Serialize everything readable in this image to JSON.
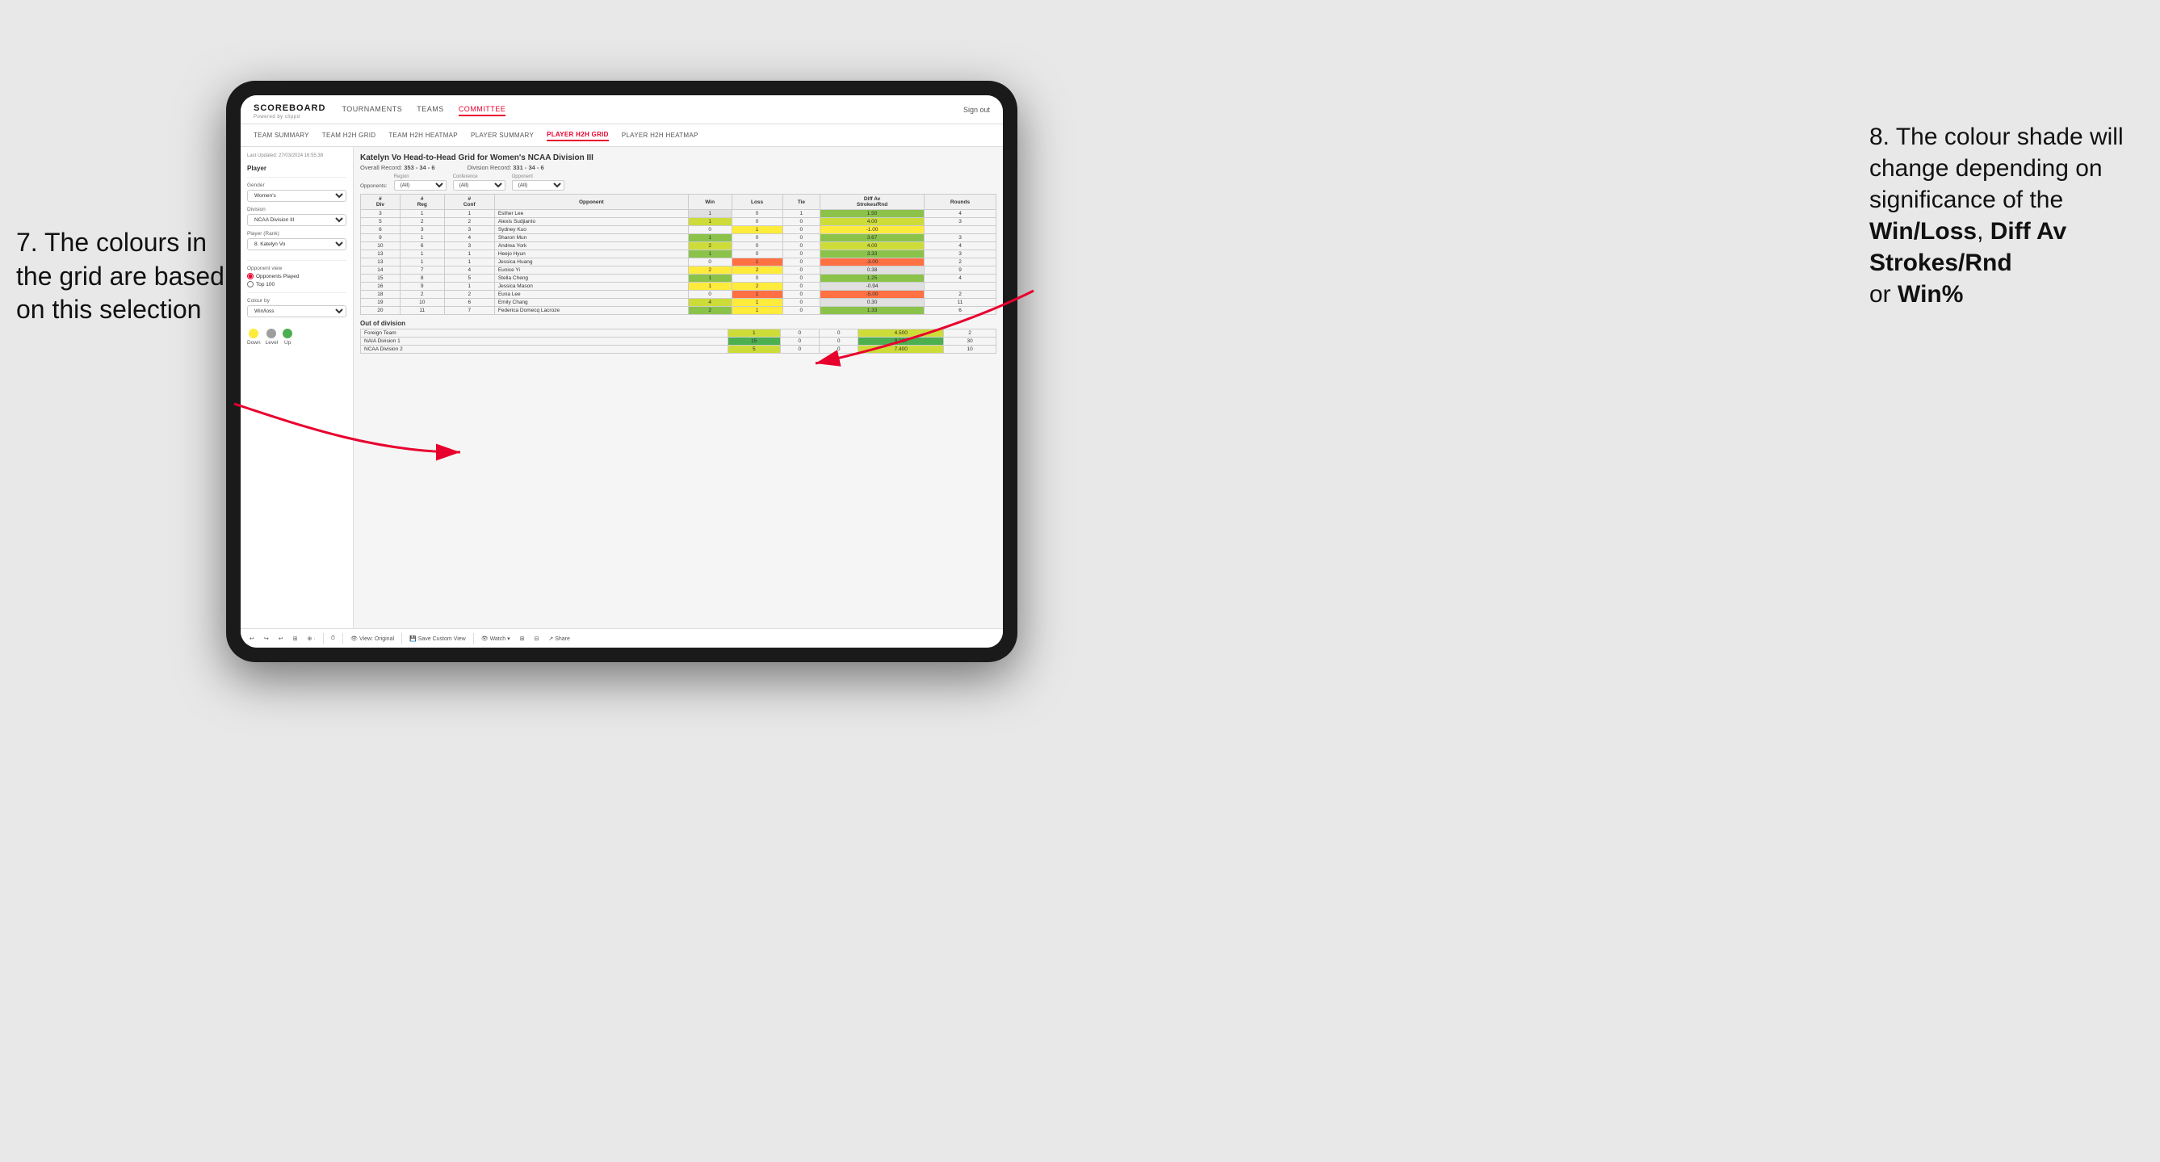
{
  "app": {
    "logo": "SCOREBOARD",
    "logo_sub": "Powered by clippd",
    "nav": [
      "TOURNAMENTS",
      "TEAMS",
      "COMMITTEE"
    ],
    "nav_active": "COMMITTEE",
    "nav_right": "Sign out",
    "sub_nav": [
      "TEAM SUMMARY",
      "TEAM H2H GRID",
      "TEAM H2H HEATMAP",
      "PLAYER SUMMARY",
      "PLAYER H2H GRID",
      "PLAYER H2H HEATMAP"
    ],
    "sub_nav_active": "PLAYER H2H GRID"
  },
  "left_panel": {
    "timestamp": "Last Updated: 27/03/2024 16:55:38",
    "player_section": "Player",
    "gender_label": "Gender",
    "gender_value": "Women's",
    "division_label": "Division",
    "division_value": "NCAA Division III",
    "player_rank_label": "Player (Rank)",
    "player_rank_value": "8. Katelyn Vo",
    "opponent_view_label": "Opponent view",
    "opponent_view_options": [
      "Opponents Played",
      "Top 100"
    ],
    "opponent_view_selected": "Opponents Played",
    "colour_by_label": "Colour by",
    "colour_by_value": "Win/loss",
    "legend": {
      "down_label": "Down",
      "level_label": "Level",
      "up_label": "Up",
      "down_color": "#FFEB3B",
      "level_color": "#9E9E9E",
      "up_color": "#4CAF50"
    }
  },
  "grid": {
    "title": "Katelyn Vo Head-to-Head Grid for Women's NCAA Division III",
    "overall_record_label": "Overall Record:",
    "overall_record_value": "353 - 34 - 6",
    "division_record_label": "Division Record:",
    "division_record_value": "331 - 34 - 6",
    "filters": {
      "opponents_label": "Opponents:",
      "region_label": "Region",
      "region_value": "(All)",
      "conference_label": "Conference",
      "conference_value": "(All)",
      "opponent_label": "Opponent",
      "opponent_value": "(All)"
    },
    "column_headers": [
      "#\nDiv",
      "#\nReg",
      "#\nConf",
      "Opponent",
      "Win",
      "Loss",
      "Tie",
      "Diff Av\nStrokes/Rnd",
      "Rounds"
    ],
    "rows": [
      {
        "div": "3",
        "reg": "1",
        "conf": "1",
        "opponent": "Esther Lee",
        "win": "1",
        "loss": "0",
        "tie": "1",
        "diff": "1.50",
        "rounds": "4",
        "win_color": "cell-gray",
        "loss_color": "",
        "diff_color": "cell-green-light"
      },
      {
        "div": "5",
        "reg": "2",
        "conf": "2",
        "opponent": "Alexis Sudjianto",
        "win": "1",
        "loss": "0",
        "tie": "0",
        "diff": "4.00",
        "rounds": "3",
        "win_color": "cell-green-mid",
        "loss_color": "",
        "diff_color": "cell-green-mid"
      },
      {
        "div": "6",
        "reg": "3",
        "conf": "3",
        "opponent": "Sydney Kuo",
        "win": "0",
        "loss": "1",
        "tie": "0",
        "diff": "-1.00",
        "rounds": "",
        "win_color": "",
        "loss_color": "cell-yellow",
        "diff_color": "cell-yellow"
      },
      {
        "div": "9",
        "reg": "1",
        "conf": "4",
        "opponent": "Sharon Mun",
        "win": "1",
        "loss": "0",
        "tie": "0",
        "diff": "3.67",
        "rounds": "3",
        "win_color": "cell-green-light",
        "loss_color": "",
        "diff_color": "cell-green-light"
      },
      {
        "div": "10",
        "reg": "6",
        "conf": "3",
        "opponent": "Andrea York",
        "win": "2",
        "loss": "0",
        "tie": "0",
        "diff": "4.00",
        "rounds": "4",
        "win_color": "cell-green-mid",
        "loss_color": "",
        "diff_color": "cell-green-mid"
      },
      {
        "div": "13",
        "reg": "1",
        "conf": "1",
        "opponent": "Heejo Hyun",
        "win": "1",
        "loss": "0",
        "tie": "0",
        "diff": "3.33",
        "rounds": "3",
        "win_color": "cell-green-light",
        "loss_color": "",
        "diff_color": "cell-green-light"
      },
      {
        "div": "13",
        "reg": "1",
        "conf": "1",
        "opponent": "Jessica Huang",
        "win": "0",
        "loss": "1",
        "tie": "0",
        "diff": "-3.00",
        "rounds": "2",
        "win_color": "",
        "loss_color": "cell-red-light",
        "diff_color": "cell-red-light"
      },
      {
        "div": "14",
        "reg": "7",
        "conf": "4",
        "opponent": "Eunice Yi",
        "win": "2",
        "loss": "2",
        "tie": "0",
        "diff": "0.38",
        "rounds": "9",
        "win_color": "cell-yellow",
        "loss_color": "cell-yellow",
        "diff_color": "cell-gray"
      },
      {
        "div": "15",
        "reg": "8",
        "conf": "5",
        "opponent": "Stella Cheng",
        "win": "1",
        "loss": "0",
        "tie": "0",
        "diff": "1.25",
        "rounds": "4",
        "win_color": "cell-green-light",
        "loss_color": "",
        "diff_color": "cell-green-light"
      },
      {
        "div": "16",
        "reg": "9",
        "conf": "1",
        "opponent": "Jessica Mason",
        "win": "1",
        "loss": "2",
        "tie": "0",
        "diff": "-0.94",
        "rounds": "",
        "win_color": "cell-yellow",
        "loss_color": "cell-yellow",
        "diff_color": "cell-gray"
      },
      {
        "div": "18",
        "reg": "2",
        "conf": "2",
        "opponent": "Euna Lee",
        "win": "0",
        "loss": "1",
        "tie": "0",
        "diff": "-5.00",
        "rounds": "2",
        "win_color": "",
        "loss_color": "cell-red-light",
        "diff_color": "cell-red-light"
      },
      {
        "div": "19",
        "reg": "10",
        "conf": "6",
        "opponent": "Emily Chang",
        "win": "4",
        "loss": "1",
        "tie": "0",
        "diff": "0.30",
        "rounds": "11",
        "win_color": "cell-green-mid",
        "loss_color": "cell-yellow",
        "diff_color": "cell-gray"
      },
      {
        "div": "20",
        "reg": "11",
        "conf": "7",
        "opponent": "Federica Domecq Lacroze",
        "win": "2",
        "loss": "1",
        "tie": "0",
        "diff": "1.33",
        "rounds": "6",
        "win_color": "cell-green-light",
        "loss_color": "cell-yellow",
        "diff_color": "cell-green-light"
      }
    ],
    "out_of_division": {
      "title": "Out of division",
      "rows": [
        {
          "name": "Foreign Team",
          "win": "1",
          "loss": "0",
          "tie": "0",
          "diff": "4.500",
          "rounds": "2",
          "win_color": "cell-green-mid",
          "diff_color": "cell-green-mid"
        },
        {
          "name": "NAIA Division 1",
          "win": "15",
          "loss": "0",
          "tie": "0",
          "diff": "9.267",
          "rounds": "30",
          "win_color": "cell-green-dark",
          "diff_color": "cell-green-dark"
        },
        {
          "name": "NCAA Division 2",
          "win": "5",
          "loss": "0",
          "tie": "0",
          "diff": "7.400",
          "rounds": "10",
          "win_color": "cell-green-mid",
          "diff_color": "cell-green-mid"
        }
      ]
    }
  },
  "toolbar": {
    "view_original": "View: Original",
    "save_custom_view": "Save Custom View",
    "watch": "Watch",
    "share": "Share"
  },
  "annotations": {
    "left_text_1": "7. The colours in",
    "left_text_2": "the grid are based",
    "left_text_3": "on this selection",
    "right_text_intro": "8. The colour shade will change depending on significance of the",
    "right_bold_1": "Win/Loss",
    "right_text_mid": ", ",
    "right_bold_2": "Diff Av Strokes/Rnd",
    "right_text_end": " or",
    "right_bold_3": "Win%"
  }
}
